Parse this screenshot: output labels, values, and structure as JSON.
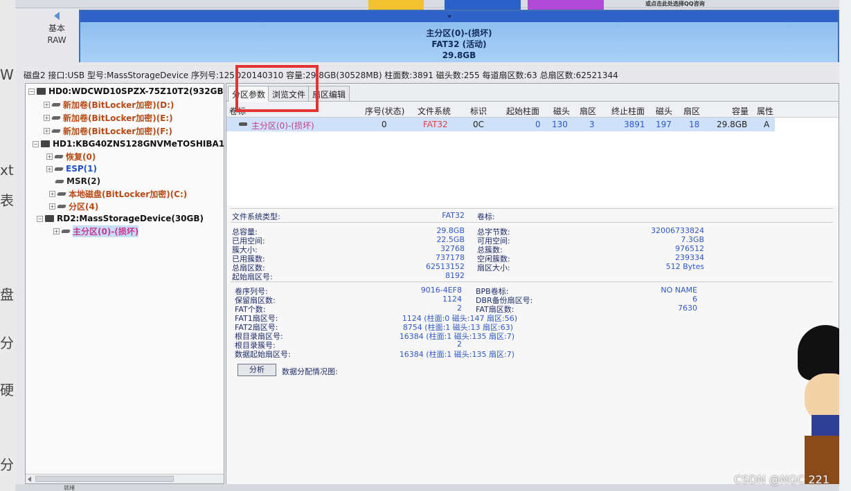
{
  "outer_page": {
    "left_fragments": [
      "W",
      "xt",
      "表",
      "盘",
      "分",
      "硬",
      "分"
    ],
    "watermark": "CSDN @NGC 221"
  },
  "toolbar": {
    "ad_hint": "或点击此处选择QQ咨询"
  },
  "disk_nav": {
    "type_label": "基本",
    "format_label": "RAW"
  },
  "partition_bar": {
    "name": "主分区(0)-(损坏)",
    "fs": "FAT32 (活动)",
    "size": "29.8GB"
  },
  "disk_info": "磁盘2 接口:USB 型号:MassStorageDevice 序列号:125D20140310 容量:29.8GB(30528MB) 柱面数:3891 磁头数:255 每道扇区数:63 总扇区数:62521344",
  "tree": {
    "items": [
      {
        "label": "HD0:WDCWD10SPZX-75Z10T2(932GB",
        "kind": "disk"
      },
      {
        "label": "新加卷(BitLocker加密)(D:)",
        "kind": "bl"
      },
      {
        "label": "新加卷(BitLocker加密)(E:)",
        "kind": "bl"
      },
      {
        "label": "新加卷(BitLocker加密)(F:)",
        "kind": "bl"
      },
      {
        "label": "HD1:KBG40ZNS128GNVMeTOSHIBA1:",
        "kind": "disk"
      },
      {
        "label": "恢复(0)",
        "kind": "bl"
      },
      {
        "label": "ESP(1)",
        "kind": "esp"
      },
      {
        "label": "MSR(2)",
        "kind": "msr"
      },
      {
        "label": "本地磁盘(BitLocker加密)(C:)",
        "kind": "bl"
      },
      {
        "label": "分区(4)",
        "kind": "bl"
      },
      {
        "label": "RD2:MassStorageDevice(30GB)",
        "kind": "disk"
      },
      {
        "label": "主分区(0)-(损坏)",
        "kind": "bad"
      }
    ]
  },
  "tabs": [
    "分区参数",
    "浏览文件",
    "扇区编辑"
  ],
  "grid": {
    "columns": [
      "卷标",
      "序号(状态)",
      "文件系统",
      "标识",
      "起始柱面",
      "磁头",
      "扇区",
      "终止柱面",
      "磁头",
      "扇区",
      "容量",
      "属性"
    ],
    "row": [
      "主分区(0)-(损坏)",
      "0",
      "FAT32",
      "0C",
      "0",
      "130",
      "3",
      "3891",
      "197",
      "18",
      "29.8GB",
      "A"
    ]
  },
  "details": {
    "fs_type_label": "文件系统类型:",
    "fs_type_value": "FAT32",
    "volume_label": "卷标:",
    "left_block1": [
      {
        "k": "总容量:",
        "v": "29.8GB"
      },
      {
        "k": "已用空间:",
        "v": "22.5GB"
      },
      {
        "k": "簇大小:",
        "v": "32768"
      },
      {
        "k": "已用簇数:",
        "v": "737178"
      },
      {
        "k": "总扇区数:",
        "v": "62513152"
      },
      {
        "k": "起始扇区号:",
        "v": "8192"
      }
    ],
    "right_block1": [
      {
        "k": "总字节数:",
        "v": "32006733824"
      },
      {
        "k": "可用空间:",
        "v": "7.3GB"
      },
      {
        "k": "总簇数:",
        "v": "976512"
      },
      {
        "k": "空闲簇数:",
        "v": "239334"
      },
      {
        "k": "扇区大小:",
        "v": "512 Bytes"
      }
    ],
    "left_block2": [
      {
        "k": "卷序列号:",
        "v": "9016-4EF8"
      },
      {
        "k": "保留扇区数:",
        "v": "1124"
      },
      {
        "k": "FAT个数:",
        "v": "2"
      },
      {
        "k": "FAT1扇区号:",
        "v": "1124 (柱面:0 磁头:147 扇区:56)"
      },
      {
        "k": "FAT2扇区号:",
        "v": "8754 (柱面:1 磁头:13 扇区:63)"
      },
      {
        "k": "根目录扇区号:",
        "v": "16384 (柱面:1 磁头:135 扇区:7)"
      },
      {
        "k": "根目录簇号:",
        "v": "2"
      },
      {
        "k": "数据起始扇区号:",
        "v": "16384 (柱面:1 磁头:135 扇区:7)"
      }
    ],
    "right_block2": [
      {
        "k": "BPB卷标:",
        "v": "NO NAME"
      },
      {
        "k": "DBR备份扇区号:",
        "v": "6"
      },
      {
        "k": "FAT扇区数:",
        "v": "7630"
      }
    ],
    "analyze_button": "分析",
    "distribution_label": "数据分配情况图:"
  },
  "status_bar": "就绪",
  "colors": {
    "highlight": "#e23434",
    "partition_blue": "#2f63c9",
    "fat32_red": "#d84545"
  }
}
